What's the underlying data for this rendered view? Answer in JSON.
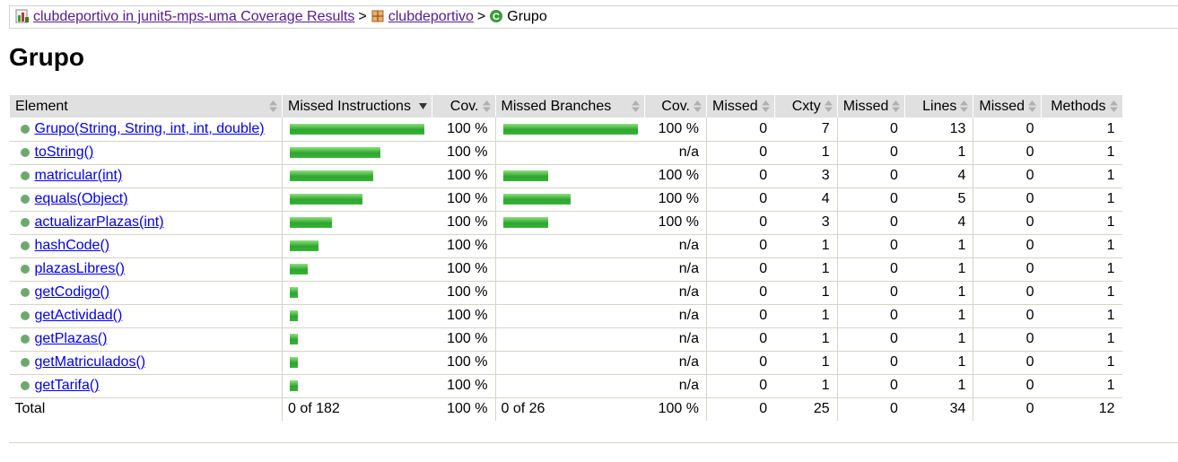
{
  "breadcrumb": {
    "report_link": "clubdeportivo in junit5-mps-uma Coverage Results",
    "package_link": "clubdeportivo",
    "class_name": "Grupo",
    "separator": ">",
    "report_icon": "report-icon",
    "package_icon": "package-icon",
    "class_icon": "class-icon"
  },
  "page_title": "Grupo",
  "table": {
    "headers": [
      "Element",
      "Missed Instructions",
      "Cov.",
      "Missed Branches",
      "Cov.",
      "Missed",
      "Cxty",
      "Missed",
      "Lines",
      "Missed",
      "Methods"
    ],
    "rows": [
      {
        "name": "Grupo(String, String, int, int, double)",
        "instr_bar": 1.0,
        "instr_cov": "100 %",
        "branch_bar": 1.0,
        "branch_cov": "100 %",
        "missed_cxty": "0",
        "cxty": "7",
        "missed_lines": "0",
        "lines": "13",
        "missed_methods": "0",
        "methods": "1"
      },
      {
        "name": "toString()",
        "instr_bar": 0.67,
        "instr_cov": "100 %",
        "branch_bar": 0,
        "branch_cov": "n/a",
        "missed_cxty": "0",
        "cxty": "1",
        "missed_lines": "0",
        "lines": "1",
        "missed_methods": "0",
        "methods": "1"
      },
      {
        "name": "matricular(int)",
        "instr_bar": 0.62,
        "instr_cov": "100 %",
        "branch_bar": 0.33,
        "branch_cov": "100 %",
        "missed_cxty": "0",
        "cxty": "3",
        "missed_lines": "0",
        "lines": "4",
        "missed_methods": "0",
        "methods": "1"
      },
      {
        "name": "equals(Object)",
        "instr_bar": 0.54,
        "instr_cov": "100 %",
        "branch_bar": 0.5,
        "branch_cov": "100 %",
        "missed_cxty": "0",
        "cxty": "4",
        "missed_lines": "0",
        "lines": "5",
        "missed_methods": "0",
        "methods": "1"
      },
      {
        "name": "actualizarPlazas(int)",
        "instr_bar": 0.31,
        "instr_cov": "100 %",
        "branch_bar": 0.33,
        "branch_cov": "100 %",
        "missed_cxty": "0",
        "cxty": "3",
        "missed_lines": "0",
        "lines": "4",
        "missed_methods": "0",
        "methods": "1"
      },
      {
        "name": "hashCode()",
        "instr_bar": 0.21,
        "instr_cov": "100 %",
        "branch_bar": 0,
        "branch_cov": "n/a",
        "missed_cxty": "0",
        "cxty": "1",
        "missed_lines": "0",
        "lines": "1",
        "missed_methods": "0",
        "methods": "1"
      },
      {
        "name": "plazasLibres()",
        "instr_bar": 0.13,
        "instr_cov": "100 %",
        "branch_bar": 0,
        "branch_cov": "n/a",
        "missed_cxty": "0",
        "cxty": "1",
        "missed_lines": "0",
        "lines": "1",
        "missed_methods": "0",
        "methods": "1"
      },
      {
        "name": "getCodigo()",
        "instr_bar": 0.06,
        "instr_cov": "100 %",
        "branch_bar": 0,
        "branch_cov": "n/a",
        "missed_cxty": "0",
        "cxty": "1",
        "missed_lines": "0",
        "lines": "1",
        "missed_methods": "0",
        "methods": "1"
      },
      {
        "name": "getActividad()",
        "instr_bar": 0.06,
        "instr_cov": "100 %",
        "branch_bar": 0,
        "branch_cov": "n/a",
        "missed_cxty": "0",
        "cxty": "1",
        "missed_lines": "0",
        "lines": "1",
        "missed_methods": "0",
        "methods": "1"
      },
      {
        "name": "getPlazas()",
        "instr_bar": 0.06,
        "instr_cov": "100 %",
        "branch_bar": 0,
        "branch_cov": "n/a",
        "missed_cxty": "0",
        "cxty": "1",
        "missed_lines": "0",
        "lines": "1",
        "missed_methods": "0",
        "methods": "1"
      },
      {
        "name": "getMatriculados()",
        "instr_bar": 0.06,
        "instr_cov": "100 %",
        "branch_bar": 0,
        "branch_cov": "n/a",
        "missed_cxty": "0",
        "cxty": "1",
        "missed_lines": "0",
        "lines": "1",
        "missed_methods": "0",
        "methods": "1"
      },
      {
        "name": "getTarifa()",
        "instr_bar": 0.06,
        "instr_cov": "100 %",
        "branch_bar": 0,
        "branch_cov": "n/a",
        "missed_cxty": "0",
        "cxty": "1",
        "missed_lines": "0",
        "lines": "1",
        "missed_methods": "0",
        "methods": "1"
      }
    ],
    "total": {
      "label": "Total",
      "missed_instructions": "0 of 182",
      "instr_cov": "100 %",
      "missed_branches": "0 of 26",
      "branch_cov": "100 %",
      "missed_cxty": "0",
      "cxty": "25",
      "missed_lines": "0",
      "lines": "34",
      "missed_methods": "0",
      "methods": "12"
    }
  },
  "colors": {
    "bar_green": "#2ea62e",
    "header_bg": "#e0e0e0",
    "link": "#0000ee",
    "visited_link": "#551a8b",
    "method_dot": "#6fa86f"
  }
}
